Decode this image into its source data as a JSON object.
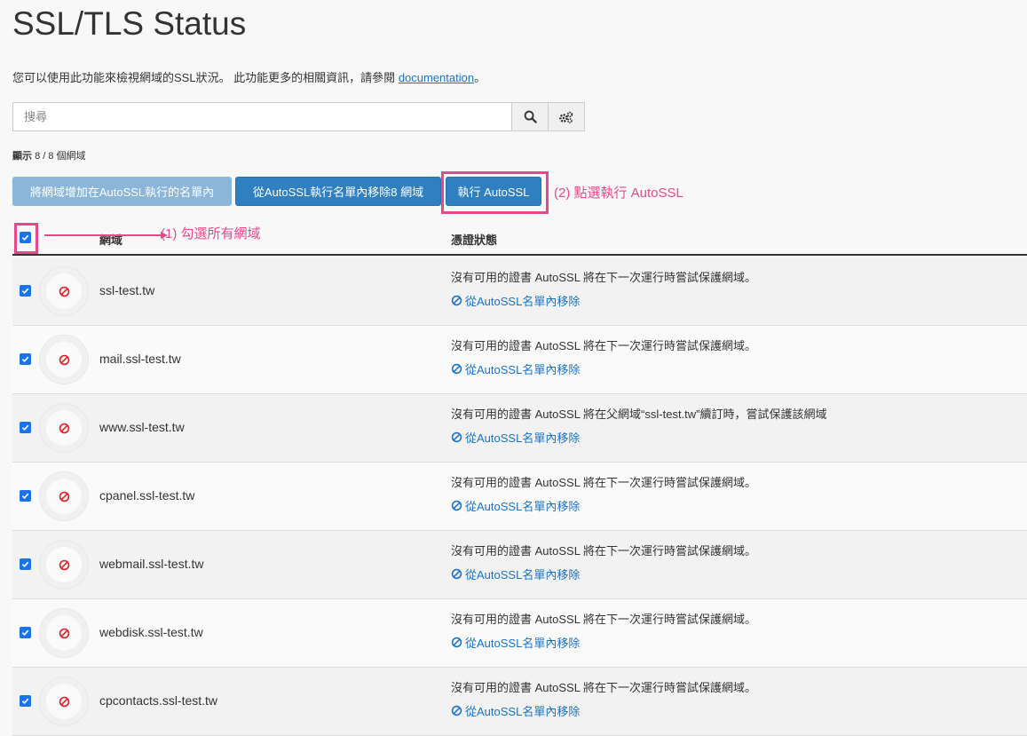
{
  "page": {
    "title": "SSL/TLS Status",
    "description_prefix": "您可以使用此功能來檢視網域的SSL狀況。 此功能更多的相關資訊，請參閱",
    "description_link": "documentation",
    "description_suffix": "。"
  },
  "search": {
    "placeholder": "搜尋",
    "value": ""
  },
  "count": {
    "label": "顯示",
    "text": "8 / 8 個網域"
  },
  "actions": {
    "add_label": "將網域增加在AutoSSL執行的名單內",
    "remove_label": "從AutoSSL執行名單內移除8 網域",
    "run_label": "執行 AutoSSL"
  },
  "annotations": {
    "step1": "(1) 勾選所有網域",
    "step2": "(2) 點選執行 AutoSSL"
  },
  "table": {
    "col_domain": "網域",
    "col_status": "憑證狀態",
    "remove_link": "從AutoSSL名單內移除",
    "rows": [
      {
        "domain": "ssl-test.tw",
        "status": "沒有可用的證書 AutoSSL 將在下一次運行時嘗試保護網域。"
      },
      {
        "domain": "mail.ssl-test.tw",
        "status": "沒有可用的證書 AutoSSL 將在下一次運行時嘗試保護網域。"
      },
      {
        "domain": "www.ssl-test.tw",
        "status": "沒有可用的證書 AutoSSL 將在父網域“ssl-test.tw”續訂時，嘗試保護該網域"
      },
      {
        "domain": "cpanel.ssl-test.tw",
        "status": "沒有可用的證書 AutoSSL 將在下一次運行時嘗試保護網域。"
      },
      {
        "domain": "webmail.ssl-test.tw",
        "status": "沒有可用的證書 AutoSSL 將在下一次運行時嘗試保護網域。"
      },
      {
        "domain": "webdisk.ssl-test.tw",
        "status": "沒有可用的證書 AutoSSL 將在下一次運行時嘗試保護網域。"
      },
      {
        "domain": "cpcontacts.ssl-test.tw",
        "status": "沒有可用的證書 AutoSSL 將在下一次運行時嘗試保護網域。"
      }
    ]
  },
  "colors": {
    "accent": "#2f7fc1",
    "annotation": "#e6488a",
    "error": "#d9262c",
    "link": "#1a73c6"
  },
  "icons": {
    "search": "search-icon",
    "settings": "gears-icon",
    "status": "no-entry-icon",
    "remove": "ban-icon"
  }
}
